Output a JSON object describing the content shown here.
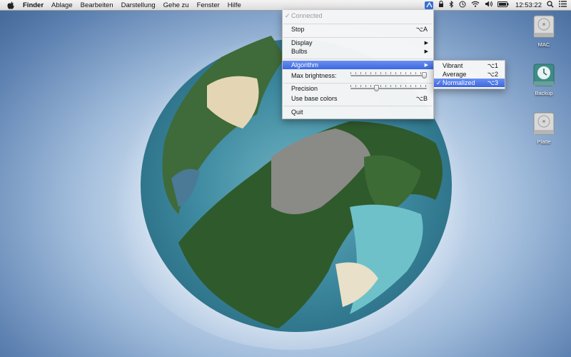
{
  "menubar": {
    "items": [
      "Finder",
      "Ablage",
      "Bearbeiten",
      "Darstellung",
      "Gehe zu",
      "Fenster",
      "Hilfe"
    ],
    "clock": "12:53:22"
  },
  "dropdown": {
    "connected": "Connected",
    "connected_check": "✓",
    "stop": {
      "label": "Stop",
      "shortcut": "⌥A"
    },
    "display": "Display",
    "bulbs": "Bulbs",
    "algorithm": "Algorithm",
    "max_brightness": "Max brightness:",
    "max_brightness_value": 1.0,
    "precision": "Precision",
    "precision_value": 0.33,
    "use_base_colors": {
      "label": "Use base colors",
      "shortcut": "⌥B"
    },
    "quit": "Quit",
    "arrow": "▶"
  },
  "submenu": {
    "items": [
      {
        "label": "Vibrant",
        "shortcut": "⌥1",
        "checked": false
      },
      {
        "label": "Average",
        "shortcut": "⌥2",
        "checked": false
      },
      {
        "label": "Normalized",
        "shortcut": "⌥3",
        "checked": true
      }
    ],
    "check": "✓"
  },
  "desktop": {
    "drives": [
      "MAC",
      "Backup",
      "Platte"
    ]
  },
  "colors": {
    "highlight": "#3c67e0",
    "menubar": "#e6e6e6",
    "sky": "#5f83b2"
  }
}
